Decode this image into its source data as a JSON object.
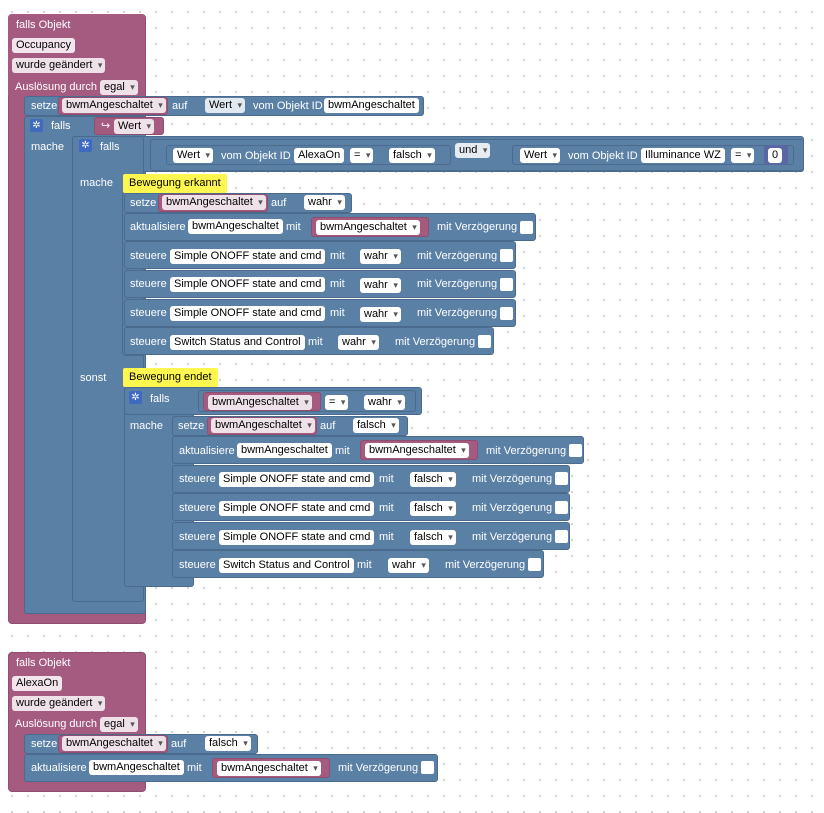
{
  "block1": {
    "trigger_title": "falls Objekt",
    "trigger_object": "Occupancy",
    "changed": "wurde geändert",
    "trigger_label": "Auslösung durch",
    "trigger_value": "egal",
    "set1": {
      "setze": "setze",
      "var": "bwmAngeschaltet",
      "auf": "auf",
      "wert": "Wert",
      "vom": "vom Objekt ID",
      "obj": "bwmAngeschaltet"
    },
    "if1": {
      "falls": "falls",
      "var_icon": "↪",
      "wert": "Wert",
      "mache": "mache"
    },
    "if2": {
      "falls": "falls",
      "c1_wert": "Wert",
      "c1_vom": "vom Objekt ID",
      "c1_obj": "AlexaOn",
      "c1_op": "=",
      "c1_val": "falsch",
      "und": "und",
      "c2_wert": "Wert",
      "c2_vom": "vom Objekt ID",
      "c2_obj": "Illuminance WZ",
      "c2_op": "=",
      "c2_val": "0",
      "mache": "mache",
      "sonst": "sonst"
    },
    "comment1": "Bewegung erkannt",
    "then_rows": {
      "set": {
        "setze": "setze",
        "var": "bwmAngeschaltet",
        "auf": "auf",
        "val": "wahr"
      },
      "upd": {
        "akt": "aktualisiere",
        "obj": "bwmAngeschaltet",
        "mit": "mit",
        "var": "bwmAngeschaltet",
        "delay": "mit Verzögerung"
      },
      "ctl1": {
        "steuere": "steuere",
        "obj": "Simple ONOFF state and cmd",
        "mit": "mit",
        "val": "wahr",
        "delay": "mit Verzögerung"
      },
      "ctl2": {
        "steuere": "steuere",
        "obj": "Simple ONOFF state and cmd",
        "mit": "mit",
        "val": "wahr",
        "delay": "mit Verzögerung"
      },
      "ctl3": {
        "steuere": "steuere",
        "obj": "Simple ONOFF state and cmd",
        "mit": "mit",
        "val": "wahr",
        "delay": "mit Verzögerung"
      },
      "ctl4": {
        "steuere": "steuere",
        "obj": "Switch Status and Control",
        "mit": "mit",
        "val": "wahr",
        "delay": "mit Verzögerung"
      }
    },
    "comment2": "Bewegung endet",
    "if3": {
      "falls": "falls",
      "var": "bwmAngeschaltet",
      "op": "=",
      "val": "wahr",
      "mache": "mache"
    },
    "else_rows": {
      "set": {
        "setze": "setze",
        "var": "bwmAngeschaltet",
        "auf": "auf",
        "val": "falsch"
      },
      "upd": {
        "akt": "aktualisiere",
        "obj": "bwmAngeschaltet",
        "mit": "mit",
        "var": "bwmAngeschaltet",
        "delay": "mit Verzögerung"
      },
      "ctl1": {
        "steuere": "steuere",
        "obj": "Simple ONOFF state and cmd",
        "mit": "mit",
        "val": "falsch",
        "delay": "mit Verzögerung"
      },
      "ctl2": {
        "steuere": "steuere",
        "obj": "Simple ONOFF state and cmd",
        "mit": "mit",
        "val": "falsch",
        "delay": "mit Verzögerung"
      },
      "ctl3": {
        "steuere": "steuere",
        "obj": "Simple ONOFF state and cmd",
        "mit": "mit",
        "val": "falsch",
        "delay": "mit Verzögerung"
      },
      "ctl4": {
        "steuere": "steuere",
        "obj": "Switch Status and Control",
        "mit": "mit",
        "val": "wahr",
        "delay": "mit Verzögerung"
      }
    }
  },
  "block2": {
    "trigger_title": "falls Objekt",
    "trigger_object": "AlexaOn",
    "changed": "wurde geändert",
    "trigger_label": "Auslösung durch",
    "trigger_value": "egal",
    "set": {
      "setze": "setze",
      "var": "bwmAngeschaltet",
      "auf": "auf",
      "val": "falsch"
    },
    "upd": {
      "akt": "aktualisiere",
      "obj": "bwmAngeschaltet",
      "mit": "mit",
      "var": "bwmAngeschaltet",
      "delay": "mit Verzögerung"
    }
  },
  "colors": {
    "event": "#a55b80",
    "logic": "#5b80a5",
    "comment": "#fef750",
    "gear": "#3e6bbf"
  }
}
